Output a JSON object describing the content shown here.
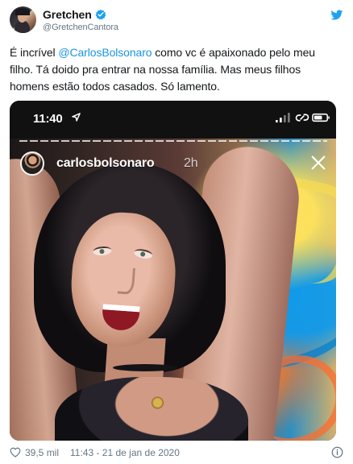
{
  "tweet": {
    "display_name": "Gretchen",
    "handle": "@GretchenCantora",
    "text_before_mention": "É incrível ",
    "mention": "@CarlosBolsonaro",
    "text_after_mention": " como vc é apaixonado pelo meu filho. Tá doido pra entrar na nossa família. Mas meus filhos homens estão todos casados. Só lamento.",
    "likes": "39,5 mil",
    "timestamp": "11:43 - 21 de jan de 2020"
  },
  "story": {
    "status_time": "11:40",
    "username": "carlosbolsonaro",
    "age": "2h"
  },
  "icons": {
    "verified": "verified-badge-icon",
    "twitter": "twitter-bird-icon",
    "location": "location-arrow-icon",
    "signal": "signal-icon",
    "link": "link-icon",
    "battery": "battery-icon",
    "close": "close-icon",
    "like": "heart-icon",
    "info": "info-icon"
  },
  "colors": {
    "twitter_blue": "#1da1f2",
    "mention_blue": "#1b95e0",
    "text_primary": "#14171a",
    "text_secondary": "#657786",
    "story_background": "#090909"
  }
}
